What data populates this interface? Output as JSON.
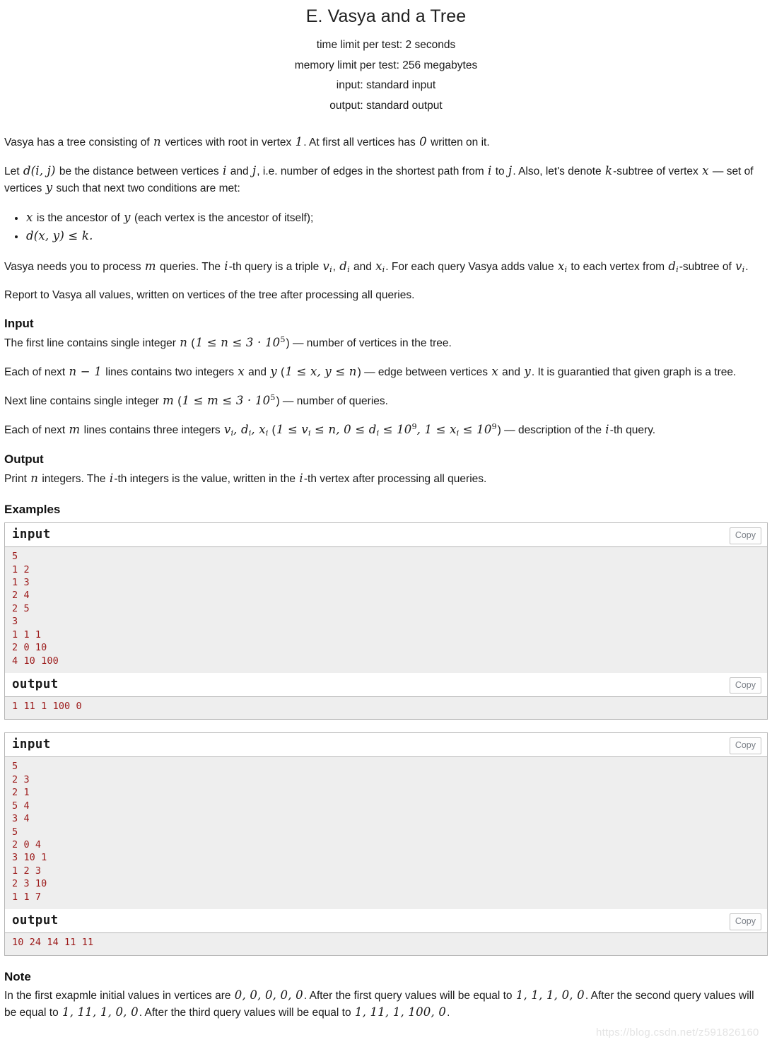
{
  "header": {
    "title": "E. Vasya and a Tree",
    "time_limit": "time limit per test: 2 seconds",
    "memory_limit": "memory limit per test: 256 megabytes",
    "input_spec": "input: standard input",
    "output_spec": "output: standard output"
  },
  "statement": {
    "p1_a": "Vasya has a tree consisting of ",
    "p1_n": "n",
    "p1_b": " vertices with root in vertex ",
    "p1_one": "1",
    "p1_c": ". At first all vertices has ",
    "p1_zero": "0",
    "p1_d": " written on it.",
    "p2_a": "Let ",
    "p2_dij": "d(i, j)",
    "p2_b": " be the distance between vertices ",
    "p2_i": "i",
    "p2_c": " and ",
    "p2_j": "j",
    "p2_d": ", i.e. number of edges in the shortest path from ",
    "p2_i2": "i",
    "p2_e": " to ",
    "p2_j2": "j",
    "p2_f": ". Also, let's denote ",
    "p2_k": "k",
    "p2_g": "-subtree of vertex ",
    "p2_x": "x",
    "p2_h": " — set of vertices ",
    "p2_y": "y",
    "p2_i3": " such that next two conditions are met:",
    "bullet1_x": "x",
    "bullet1_text": " is the ancestor of ",
    "bullet1_y": "y",
    "bullet1_tail": " (each vertex is the ancestor of itself);",
    "bullet2": "d(x, y) ≤ k.",
    "p3_a": "Vasya needs you to process ",
    "p3_m": "m",
    "p3_b": " queries. The ",
    "p3_i": "i",
    "p3_c": "-th query is a triple ",
    "p3_vi": "v",
    "p3_vi_sub": "i",
    "p3_d": ", ",
    "p3_di": "d",
    "p3_di_sub": "i",
    "p3_e": " and ",
    "p3_xi": "x",
    "p3_xi_sub": "i",
    "p3_f": ". For each query Vasya adds value ",
    "p3_xi2": "x",
    "p3_xi2_sub": "i",
    "p3_g": " to each vertex from ",
    "p3_di2": "d",
    "p3_di2_sub": "i",
    "p3_h": "-subtree of ",
    "p3_vi2": "v",
    "p3_vi2_sub": "i",
    "p3_i2": ".",
    "p4": "Report to Vasya all values, written on vertices of the tree after processing all queries."
  },
  "input_section": {
    "heading": "Input",
    "l1_a": "The first line contains single integer ",
    "l1_n": "n",
    "l1_b": " (",
    "l1_range": "1 ≤ n ≤ 3 · 10",
    "l1_exp": "5",
    "l1_c": ") — number of vertices in the tree.",
    "l2_a": "Each of next ",
    "l2_n": "n − 1",
    "l2_b": " lines contains two integers ",
    "l2_x": "x",
    "l2_c": " and ",
    "l2_y": "y",
    "l2_d": " (",
    "l2_range": "1 ≤ x, y ≤ n",
    "l2_e": ") — edge between vertices ",
    "l2_x2": "x",
    "l2_f": " and ",
    "l2_y2": "y",
    "l2_g": ". It is guarantied that given graph is a tree.",
    "l3_a": "Next line contains single integer ",
    "l3_m": "m",
    "l3_b": " (",
    "l3_range": "1 ≤ m ≤ 3 · 10",
    "l3_exp": "5",
    "l3_c": ") — number of queries.",
    "l4_a": "Each of next ",
    "l4_m": "m",
    "l4_b": " lines contains three integers ",
    "l4_vars": "v_i, d_i, x_i",
    "l4_c": " (",
    "l4_r1": "1 ≤ v",
    "l4_r1_sub": "i",
    "l4_r1b": " ≤ n, 0 ≤ d",
    "l4_r2_sub": "i",
    "l4_r2b": " ≤ 10",
    "l4_exp1": "9",
    "l4_r3": ", 1 ≤ x",
    "l4_r3_sub": "i",
    "l4_r3b": " ≤ 10",
    "l4_exp2": "9",
    "l4_d": ") — description of the ",
    "l4_i": "i",
    "l4_e": "-th query."
  },
  "output_section": {
    "heading": "Output",
    "line_a": "Print ",
    "line_n": "n",
    "line_b": " integers. The ",
    "line_i": "i",
    "line_c": "-th integers is the value, written in the ",
    "line_i2": "i",
    "line_d": "-th vertex after processing all queries."
  },
  "examples": {
    "heading": "Examples",
    "copy_label": "Copy",
    "tests": [
      {
        "input_label": "input",
        "input_text": "5\n1 2\n1 3\n2 4\n2 5\n3\n1 1 1\n2 0 10\n4 10 100",
        "output_label": "output",
        "output_text": "1 11 1 100 0"
      },
      {
        "input_label": "input",
        "input_text": "5\n2 3\n2 1\n5 4\n3 4\n5\n2 0 4\n3 10 1\n1 2 3\n2 3 10\n1 1 7",
        "output_label": "output",
        "output_text": "10 24 14 11 11"
      }
    ]
  },
  "note": {
    "heading": "Note",
    "a": "In the first exapmle initial values in vertices are ",
    "v0": "0, 0, 0, 0, 0",
    "b": ". After the first query values will be equal to ",
    "v1": "1, 1, 1, 0, 0",
    "c": ". After the second query values will be equal to ",
    "v2": "1, 11, 1, 0, 0",
    "d": ". After the third query values will be equal to ",
    "v3": "1, 11, 1, 100, 0",
    "e": "."
  },
  "watermark": {
    "text": "https://blog.csdn.net/z591826160"
  },
  "colors": {
    "sample_code": "#9c1a1a",
    "sample_bg": "#eeeeee",
    "border": "#b5b5b5",
    "copy_text": "#7a7f87"
  }
}
